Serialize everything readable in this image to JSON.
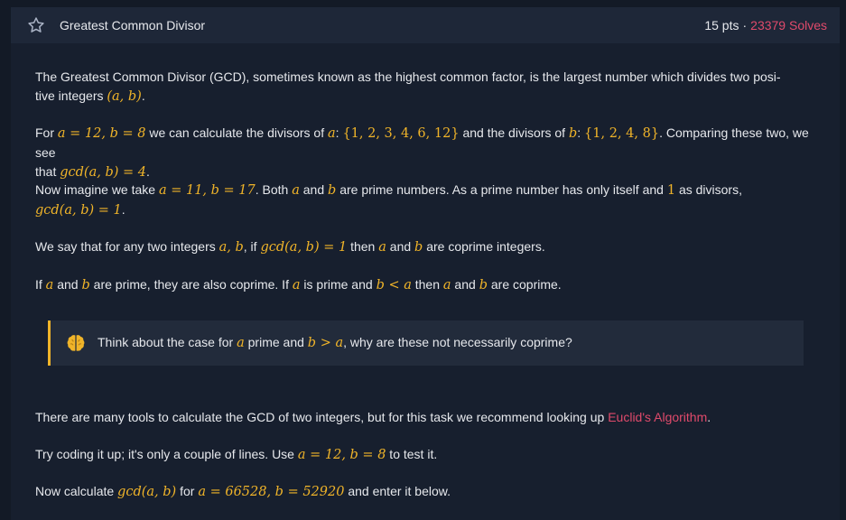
{
  "header": {
    "title": "Greatest Common Divisor",
    "points": "15 pts",
    "separator": "·",
    "solves": "23379 Solves"
  },
  "colors": {
    "accent": "#f0b429",
    "link": "#e04a6b",
    "background": "#131a26",
    "panel": "#1e2738"
  },
  "icons": {
    "favorite": "star-icon",
    "hint": "brain-icon"
  },
  "paragraphs": {
    "p1": {
      "t1": "The Greatest Common Divisor (GCD), sometimes known as the highest common factor, is the largest number which divides two posi-",
      "t2": "tive integers ",
      "m1": "(a, b)",
      "t3": "."
    },
    "p2": {
      "t1": "For ",
      "m1": "a = 12, b = 8",
      "t2": " we can calculate the divisors of ",
      "m2": "a",
      "t3": ": ",
      "m3": "{1, 2, 3, 4, 6, 12}",
      "t4": " and the divisors of ",
      "m4": "b",
      "t5": ": ",
      "m5": "{1, 2, 4, 8}",
      "t6": ". Comparing these two, we see",
      "t7": "that ",
      "m6": "gcd(a, b) = 4",
      "t8": "."
    },
    "p3": {
      "t1": "Now imagine we take ",
      "m1": "a = 11, b = 17",
      "t2": ". Both ",
      "m2": "a",
      "t3": " and ",
      "m3": "b",
      "t4": " are prime numbers. As a prime number has only itself and ",
      "m4": "1",
      "t5": " as divisors,",
      "m5": "gcd(a, b) = 1",
      "t6": "."
    },
    "p4": {
      "t1": "We say that for any two integers ",
      "m1": "a, b",
      "t2": ", if ",
      "m2": "gcd(a, b) = 1",
      "t3": " then ",
      "m3": "a",
      "t4": " and ",
      "m4": "b",
      "t5": " are coprime integers."
    },
    "p5": {
      "t1": "If ",
      "m1": "a",
      "t2": " and ",
      "m2": "b",
      "t3": " are prime, they are also coprime. If ",
      "m3": "a",
      "t4": " is prime and ",
      "m4": "b < a",
      "t5": " then ",
      "m5": "a",
      "t6": " and ",
      "m6": "b",
      "t7": " are coprime."
    },
    "callout": {
      "t1": "Think about the case for ",
      "m1": "a",
      "t2": " prime and ",
      "m2": "b > a",
      "t3": ", why are these not necessarily coprime?"
    },
    "p6": {
      "t1": "There are many tools to calculate the GCD of two integers, but for this task we recommend looking up ",
      "link": "Euclid's Algorithm",
      "t2": "."
    },
    "p7": {
      "t1": "Try coding it up; it's only a couple of lines. Use ",
      "m1": "a = 12, b = 8",
      "t2": " to test it."
    },
    "p8": {
      "t1": "Now calculate ",
      "m1": "gcd(a, b)",
      "t2": " for ",
      "m2": "a = 66528, b = 52920",
      "t3": " and enter it below."
    }
  }
}
